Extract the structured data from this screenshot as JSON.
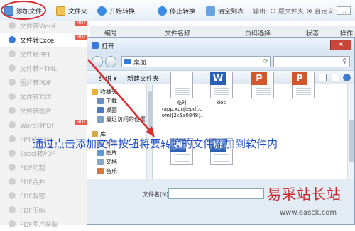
{
  "toolbar": {
    "add_file": "添加文件",
    "folder": "文件夹",
    "start": "开始转换",
    "stop": "停止转换",
    "clear": "清空列表",
    "output_label": "输出:",
    "opt_original": "原文件夹",
    "opt_custom": "自定义",
    "custom_btn": "..."
  },
  "sidebar": {
    "items": [
      {
        "label": "文件转Word",
        "hot": "HOT"
      },
      {
        "label": "文件转Excel",
        "hot": "HOT"
      },
      {
        "label": "文件转PPT",
        "hot": ""
      },
      {
        "label": "文件转HTML",
        "hot": ""
      },
      {
        "label": "图片转PDF",
        "hot": ""
      },
      {
        "label": "文件转TXT",
        "hot": ""
      },
      {
        "label": "文件转图片",
        "hot": ""
      },
      {
        "label": "Word转PDF",
        "hot": "HOT"
      },
      {
        "label": "PPT转PDF",
        "hot": ""
      },
      {
        "label": "Excel转PDF",
        "hot": ""
      },
      {
        "label": "PDF切割",
        "hot": ""
      },
      {
        "label": "PDF合并",
        "hot": ""
      },
      {
        "label": "PDF解密",
        "hot": ""
      },
      {
        "label": "PDF压缩",
        "hot": ""
      },
      {
        "label": "PDF图片获取",
        "hot": ""
      }
    ],
    "active_index": 1
  },
  "table": {
    "headers": [
      "编号",
      "文件名称",
      "页码选择",
      "状态",
      "操作"
    ]
  },
  "dialog": {
    "title": "打开",
    "close": "✕",
    "address": "桌面",
    "cmd_organize": "组织 ▾",
    "cmd_new_folder": "新建文件夹",
    "nav_items": [
      {
        "label": "收藏夹",
        "icon": "star-icon"
      },
      {
        "label": "下载",
        "icon": "download-folder-icon"
      },
      {
        "label": "桌面",
        "icon": "desktop-icon"
      },
      {
        "label": "最近访问的位置",
        "icon": "recent-icon"
      },
      {
        "label": "库",
        "icon": "library-icon"
      },
      {
        "label": "视频",
        "icon": "video-icon"
      },
      {
        "label": "图片",
        "icon": "pictures-icon"
      },
      {
        "label": "文档",
        "icon": "documents-icon"
      },
      {
        "label": "音乐",
        "icon": "music-icon"
      }
    ],
    "files": [
      {
        "caption": "临时\n(app.xunjiepdf.c\nom)[2c5a0848].",
        "kind": "text",
        "badge": ""
      },
      {
        "caption": "doc",
        "kind": "word",
        "badge": "W"
      },
      {
        "caption": "",
        "kind": "ppt",
        "badge": "P"
      },
      {
        "caption": "",
        "kind": "ppt",
        "badge": "P"
      },
      {
        "caption": "",
        "kind": "word",
        "badge": "W"
      },
      {
        "caption": "",
        "kind": "word",
        "badge": "W"
      }
    ],
    "filename_label": "文件名(N):"
  },
  "caption": "通过点击添加文件按钮将要转换的文件添加到软件内",
  "watermark": {
    "cn": "易采站长站",
    "url": "www.easck.com"
  },
  "colors": {
    "accent": "#3a7bd5",
    "red_annotation": "#d92b2b",
    "word": "#2b5fb4",
    "ppt": "#d2572c",
    "caption_blue": "#1f4fc8"
  }
}
